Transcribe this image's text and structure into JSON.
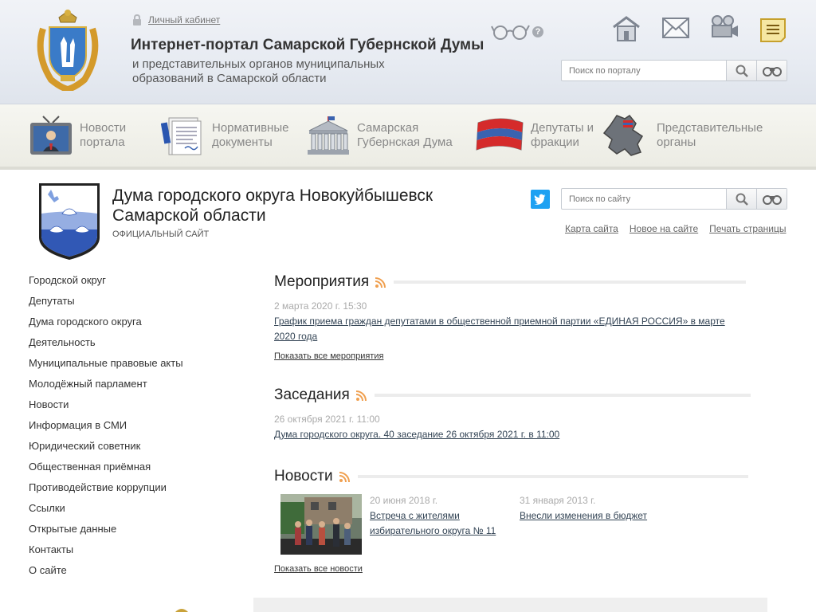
{
  "header": {
    "personal_cabinet": "Личный кабинет",
    "portal_title": "Интернет-портал Самарской Губернской Думы",
    "portal_subtitle": "и представительных органов муниципальных образований в Самарской области",
    "help_label": "?",
    "icons": [
      "low-vision-glasses-icon",
      "help-icon",
      "home-icon",
      "mail-icon",
      "video-camera-icon",
      "notes-icon"
    ],
    "search_placeholder": "Поиск по порталу"
  },
  "nav": {
    "items": [
      {
        "label": "Новости портала",
        "icon": "tv-news-icon"
      },
      {
        "label": "Нормативные документы",
        "icon": "documents-icon"
      },
      {
        "label": "Самарская Губернская Дума",
        "icon": "duma-building-icon"
      },
      {
        "label": "Депутаты и фракции",
        "icon": "flag-icon"
      },
      {
        "label": "Представительные органы",
        "icon": "region-map-icon"
      }
    ]
  },
  "site": {
    "title": "Дума городского округа Новокуйбышевск Самарской области",
    "subtitle": "ОФИЦИАЛЬНЫЙ САЙТ",
    "search_placeholder": "Поиск по сайту",
    "links": [
      "Карта сайта",
      "Новое на сайте",
      "Печать страницы"
    ]
  },
  "menu": [
    "Городской округ",
    "Депутаты",
    "Дума городского округа",
    "Деятельность",
    "Муниципальные правовые акты",
    "Молодёжный парламент",
    "Новости",
    "Информация в СМИ",
    "Юридический советник",
    "Общественная приёмная",
    "Противодействие коррупции",
    "Ссылки",
    "Открытые данные",
    "Контакты",
    "О сайте"
  ],
  "events": {
    "title": "Мероприятия",
    "date": "2 марта 2020 г.   15:30",
    "link": "График приема граждан депутатами в общественной приемной партии «ЕДИНАЯ РОССИЯ» в марте 2020 года",
    "more": "Показать все мероприятия"
  },
  "meetings": {
    "title": "Заседания",
    "date": "26 октября 2021 г. 11:00",
    "link": "Дума городского округа. 40 заседание 26 октября 2021 г. в 11:00"
  },
  "news": {
    "title": "Новости",
    "items": [
      {
        "date": "20 июня 2018 г.",
        "link": "Встреча с жителями избирательного округа № 11"
      },
      {
        "date": "31 января 2013 г.",
        "link": "Внесли изменения в бюджет"
      }
    ],
    "more": "Показать все новости"
  },
  "colors": {
    "accent_rss": "#f0a050",
    "twitter": "#1da1f2",
    "header_bg": "#e7ebf2"
  }
}
